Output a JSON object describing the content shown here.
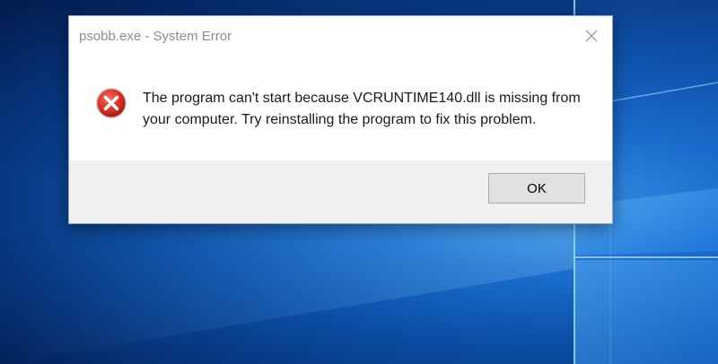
{
  "dialog": {
    "title": "psobb.exe - System Error",
    "close_icon": "close-icon",
    "icon": "error-icon",
    "message_line1": "The program can't start because VCRUNTIME140.dll is missing from",
    "message_line2": "your computer. Try reinstalling the program to fix this problem.",
    "ok_label": "OK"
  },
  "colors": {
    "error_red": "#d9352a",
    "dialog_bg": "#ffffff",
    "footer_bg": "#f0f0f0",
    "wallpaper_blue": "#0b4fa6"
  }
}
